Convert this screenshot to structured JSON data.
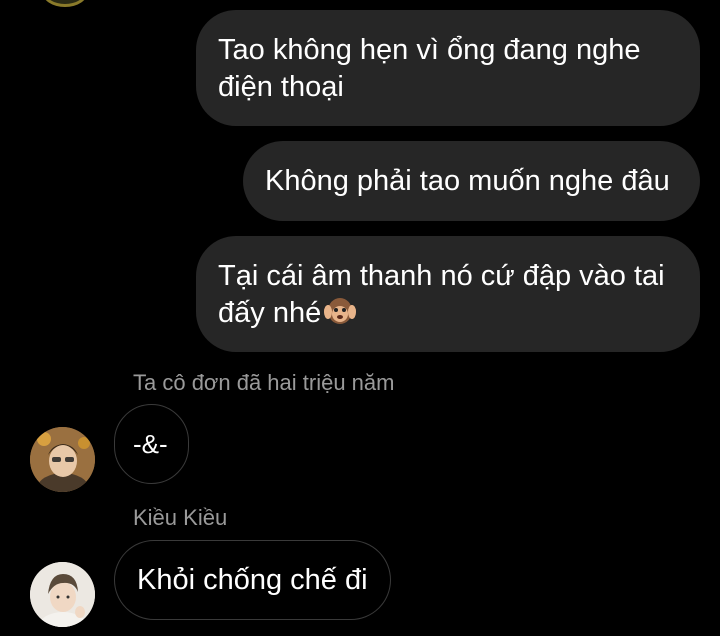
{
  "thread": {
    "outgoing": [
      {
        "text": "Tao không hẹn vì ổng đang nghe điện thoại"
      },
      {
        "text": "Không phải tao muốn nghe đâu"
      },
      {
        "text": "Tại cái âm thanh nó cứ đập vào tai đấy nhé",
        "emoji": "hear-no-evil-monkey-icon"
      }
    ],
    "incoming": [
      {
        "sender": "Ta cô đơn đã hai triệu năm",
        "text": "-&-",
        "avatar": "avatar-boy-orange-bg"
      },
      {
        "sender": "Kiều Kiều",
        "text": "Khỏi chống chế đi",
        "avatar": "avatar-boy-light-bg"
      }
    ]
  },
  "colors": {
    "background": "#000000",
    "outgoing_bubble": "#262626",
    "incoming_border": "#3a3a3a",
    "sender_name": "#9a9a9a",
    "text": "#ffffff"
  }
}
